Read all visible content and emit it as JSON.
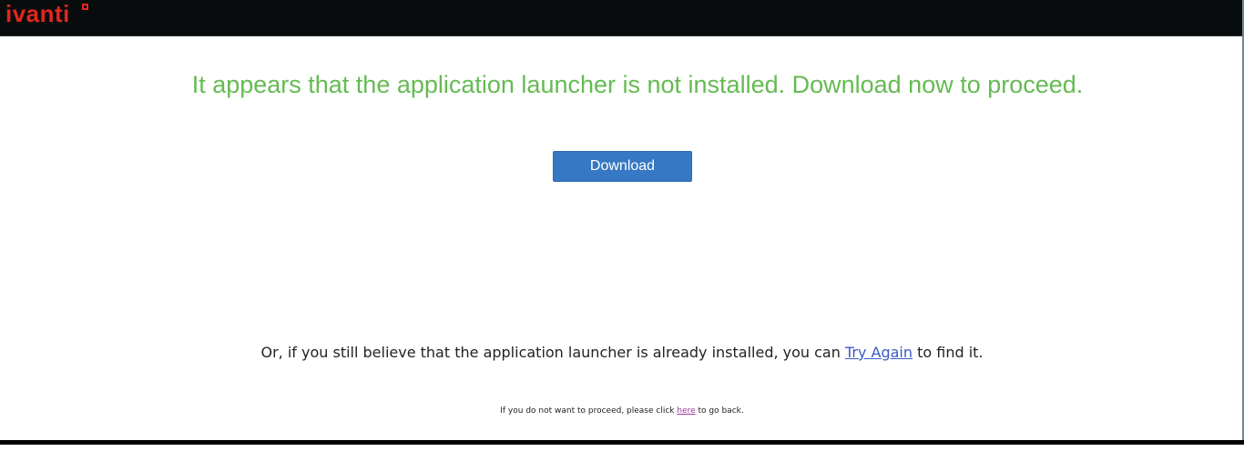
{
  "header": {
    "logo_text": "ivanti",
    "brand_color": "#e3261d",
    "bar_color": "#080c0d"
  },
  "main": {
    "headline": "It appears that the application launcher is not installed. Download now to proceed.",
    "headline_color": "#64bb52",
    "download_button_label": "Download",
    "button_color": "#3678c3",
    "retry_prefix": "Or, if you still believe that the application launcher is already installed, you can ",
    "retry_link": "Try Again",
    "retry_suffix": " to find it.",
    "back_prefix": "If you do not want to proceed, please click ",
    "back_link": "here",
    "back_suffix": " to go back."
  }
}
